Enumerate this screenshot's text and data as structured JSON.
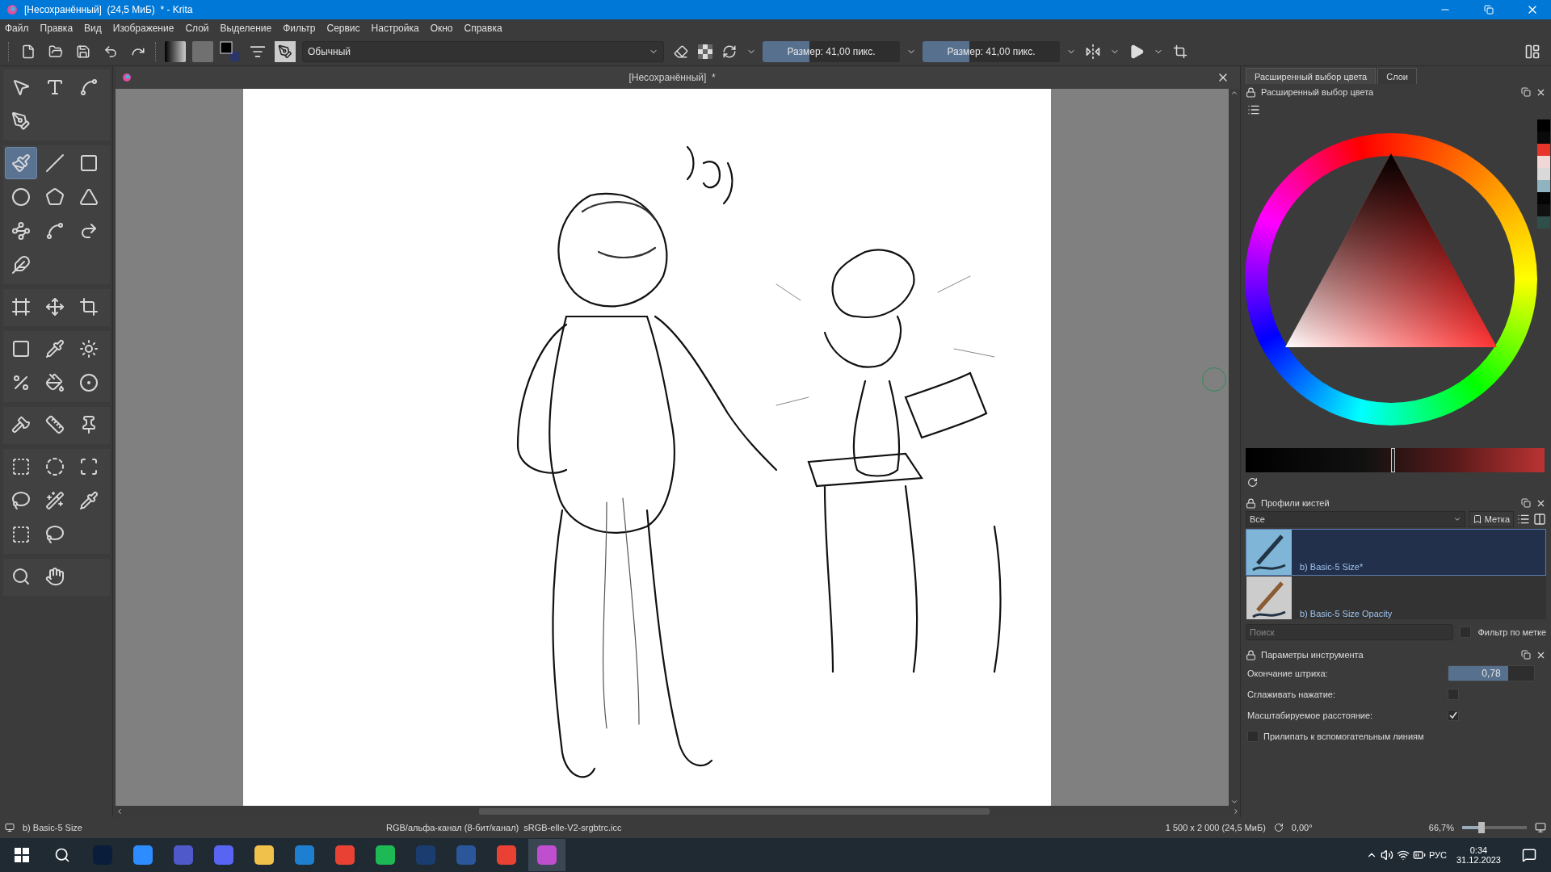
{
  "window": {
    "title": "[Несохранённый]  (24,5 МиБ)  * - Krita"
  },
  "menu": [
    "Файл",
    "Правка",
    "Вид",
    "Изображение",
    "Слой",
    "Выделение",
    "Фильтр",
    "Сервис",
    "Настройка",
    "Окно",
    "Справка"
  ],
  "toolbar": {
    "blend_mode": "Обычный",
    "sliders": [
      {
        "label": "Размер: 41,00 пикс.",
        "level": 0.34
      },
      {
        "label": "Размер: 41,00 пикс.",
        "level": 0.34
      }
    ]
  },
  "toolbox": [
    [
      {
        "selected": false
      },
      {
        "selected": false
      },
      {
        "selected": false
      },
      {
        "selected": false
      }
    ],
    [
      {
        "selected": true
      },
      {
        "selected": false
      },
      {
        "selected": false
      },
      {
        "selected": false
      },
      {
        "selected": false
      },
      {
        "selected": false
      },
      {
        "selected": false
      },
      {
        "selected": false
      },
      {
        "selected": false
      },
      {
        "selected": false
      }
    ],
    [
      {
        "selected": false
      },
      {
        "selected": false
      },
      {
        "selected": false
      }
    ],
    [
      {
        "selected": false
      },
      {
        "selected": false
      },
      {
        "selected": false
      },
      {
        "selected": false
      },
      {
        "selected": false
      },
      {
        "selected": false
      }
    ],
    [
      {
        "selected": false
      },
      {
        "selected": false
      },
      {
        "selected": false
      }
    ],
    [
      {
        "selected": false
      },
      {
        "selected": false
      },
      {
        "selected": false
      },
      {
        "selected": false
      },
      {
        "selected": false
      },
      {
        "selected": false
      },
      {
        "selected": false
      },
      {
        "selected": false
      }
    ],
    [
      {
        "selected": false
      },
      {
        "selected": false
      }
    ]
  ],
  "document": {
    "tab_title": "[Несохранённый]  *"
  },
  "dock": {
    "tabs": [
      {
        "label": "Расширенный выбор цвета",
        "selected": true
      },
      {
        "label": "Слои",
        "selected": false
      }
    ],
    "color_selector": {
      "title": "Расширенный выбор цвета",
      "recent_colors": [
        {
          "color": "#000000"
        },
        {
          "color": "#0a0a0a"
        },
        {
          "color": "#e8352b"
        },
        {
          "color": "#f2d7d7"
        },
        {
          "color": "#d9d9d9"
        },
        {
          "color": "#8fb3bf"
        },
        {
          "color": "#050505"
        },
        {
          "color": "#111111"
        },
        {
          "color": "#2f4f4a"
        }
      ]
    },
    "brush_presets": {
      "title": "Профили кистей",
      "filter": "Все",
      "tag_button": "Метка",
      "items": [
        {
          "name": "b) Basic-5 Size*",
          "selected": true
        },
        {
          "name": "b) Basic-5 Size Opacity",
          "selected": false
        }
      ],
      "search_placeholder": "Поиск",
      "filter_by_tag": {
        "label": "Фильтр по метке",
        "checked": false
      }
    },
    "tool_options": {
      "title": "Параметры инструмента",
      "rows": [
        {
          "kind": "slider",
          "label": "Окончание штриха:",
          "value": "0,78",
          "level": 0.7
        },
        {
          "kind": "checkbox",
          "label": "Сглаживать нажатие:",
          "checked": false
        },
        {
          "kind": "checkbox",
          "label": "Масштабируемое расстояние:",
          "checked": true
        },
        {
          "kind": "inline_checkbox",
          "label": "Прилипать к вспомогательным линиям",
          "checked": false
        }
      ]
    }
  },
  "status_bar": {
    "preset": "b) Basic-5 Size",
    "color_space": "RGB/альфа-канал (8-бит/канал)  sRGB-elle-V2-srgbtrc.icc",
    "image_size": "1 500 x 2 000 (24,5 МиБ)",
    "rotation": "0,00°",
    "zoom": "66,7%",
    "zoom_slider": {
      "level": 0.3
    }
  },
  "taskbar": {
    "language": "РУС",
    "time": "0:34",
    "date": "31.12.2023"
  }
}
